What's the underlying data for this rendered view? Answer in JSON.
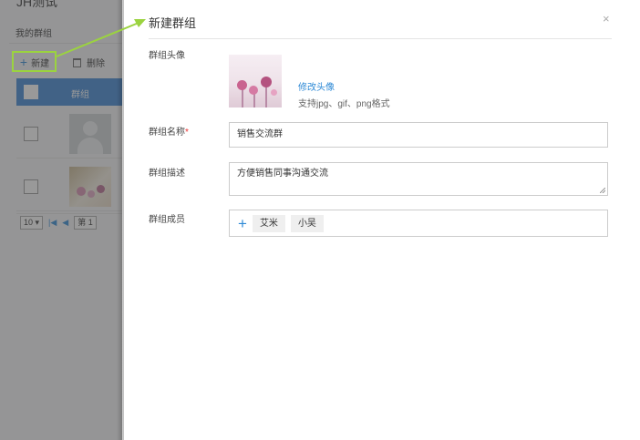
{
  "background_app": {
    "title": "JH测试",
    "tab_label": "我的群组",
    "new_button_label": "新建",
    "delete_button_label": "删除",
    "table_header": "群组",
    "pager": {
      "page_size": "10 ▾",
      "page_prefix": "第 1"
    }
  },
  "dialog": {
    "title": "新建群组",
    "close_icon": "×",
    "avatar": {
      "label": "群组头像",
      "change_link": "修改头像",
      "hint": "支持jpg、gif、png格式"
    },
    "name": {
      "label": "群组名称",
      "required_mark": "*",
      "value": "销售交流群"
    },
    "description": {
      "label": "群组描述",
      "value": "方便销售同事沟通交流"
    },
    "members": {
      "label": "群组成员",
      "add_icon": "+",
      "tags": [
        "艾米",
        "小吴"
      ]
    }
  },
  "colors": {
    "accent": "#2f8ad6",
    "table_header": "#3d86d6",
    "highlight": "#9bd33f",
    "required": "#ee3333"
  }
}
